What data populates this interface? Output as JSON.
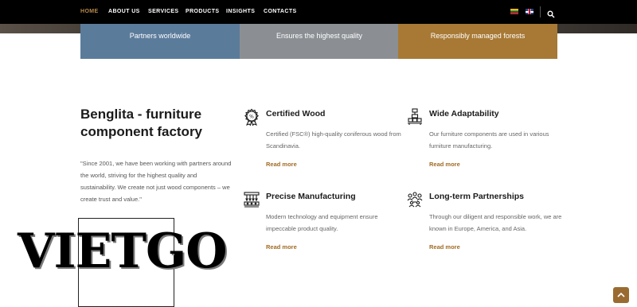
{
  "nav": {
    "items": [
      "HOME",
      "ABOUT US",
      "SERVICES",
      "PRODUCTS",
      "INSIGHTS",
      "CONTACTS"
    ],
    "active_index": 0,
    "languages": [
      "lt-flag-icon",
      "uk-flag-icon"
    ],
    "search_icon": "search-icon",
    "active_color": "#b78a4c"
  },
  "tiles": [
    {
      "text": "Partners worldwide",
      "color": "#5b7b9b"
    },
    {
      "text": "Ensures the highest quality",
      "color": "#8b8f94"
    },
    {
      "text": "Responsibly managed forests",
      "color": "#a77935"
    }
  ],
  "about": {
    "title": "Benglita - furniture component factory",
    "quote": "\"Since 2001, we have been working with partners around the world, striving for the highest quality and sustainability. We create not just wood components – we create trust and value.\""
  },
  "features": [
    {
      "icon": "certificate-badge-icon",
      "title": "Certified Wood",
      "desc": "Certified (FSC®) high-quality coniferous wood from Scandinavia.",
      "more": "Read more"
    },
    {
      "icon": "wood-stack-icon",
      "title": "Wide Adaptability",
      "desc": "Our furniture components are used in various furniture manufacturing.",
      "more": "Read more"
    },
    {
      "icon": "factory-machine-icon",
      "title": "Precise Manufacturing",
      "desc": "Modern technology and equipment ensure impeccable product quality.",
      "more": "Read more"
    },
    {
      "icon": "partners-network-icon",
      "title": "Long-term Partnerships",
      "desc": "Through our diligent and responsible work, we are known in Europe, America, and Asia.",
      "more": "Read more"
    }
  ],
  "watermark": {
    "text": "VIETGO"
  },
  "back_to_top": {
    "icon": "chevron-up-icon",
    "color": "#9a6b31"
  },
  "colors": {
    "link": "#a06b23",
    "heading": "#1b1b1b",
    "body_text": "#666666"
  }
}
